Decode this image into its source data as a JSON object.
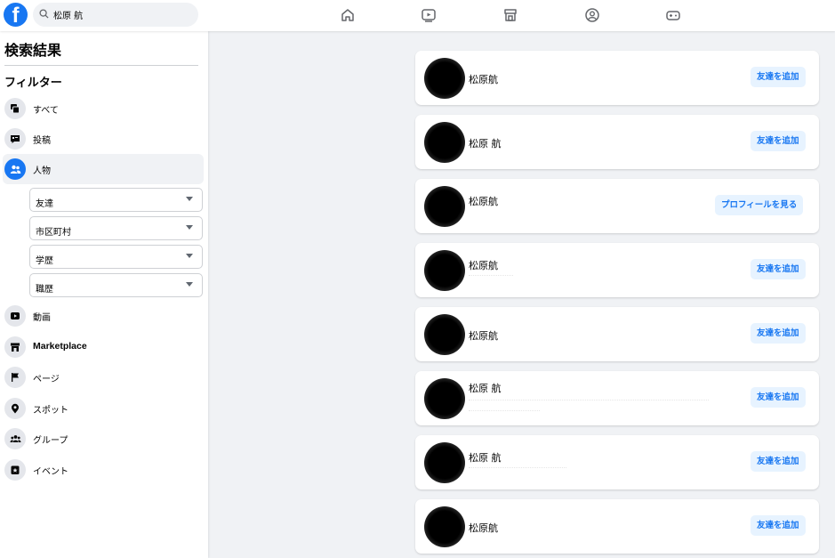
{
  "header": {
    "logo_text": "f",
    "search_value": "松原 航",
    "nav_icons": [
      "home-icon",
      "video-icon",
      "marketplace-icon",
      "groups-icon",
      "gaming-icon"
    ]
  },
  "sidebar": {
    "title": "検索結果",
    "filter_title": "フィルター",
    "items": [
      {
        "label": "すべて",
        "icon": "all-icon"
      },
      {
        "label": "投稿",
        "icon": "posts-icon"
      },
      {
        "label": "人物",
        "icon": "people-icon"
      },
      {
        "label": "動画",
        "icon": "video-icon"
      },
      {
        "label": "Marketplace",
        "icon": "marketplace-icon"
      },
      {
        "label": "ページ",
        "icon": "pages-icon"
      },
      {
        "label": "スポット",
        "icon": "places-icon"
      },
      {
        "label": "グループ",
        "icon": "groups-icon"
      },
      {
        "label": "イベント",
        "icon": "events-icon"
      }
    ],
    "active_item": "人物",
    "people_filters": [
      "友達",
      "市区町村",
      "学歴",
      "職歴"
    ]
  },
  "results": [
    {
      "name": "松原航",
      "action": "友達を追加"
    },
    {
      "name": "松原 航",
      "action": "友達を追加"
    },
    {
      "name": "松原航",
      "action": "プロフィールを見る"
    },
    {
      "name": "松原航",
      "action": "友達を追加"
    },
    {
      "name": "松原航",
      "action": "友達を追加"
    },
    {
      "name": "松原 航",
      "action": "友達を追加"
    },
    {
      "name": "松原 航",
      "action": "友達を追加"
    },
    {
      "name": "松原航",
      "action": "友達を追加"
    }
  ],
  "colors": {
    "accent": "#1877f2",
    "button_bg": "#e7f3ff",
    "page_bg": "#f0f2f5"
  }
}
